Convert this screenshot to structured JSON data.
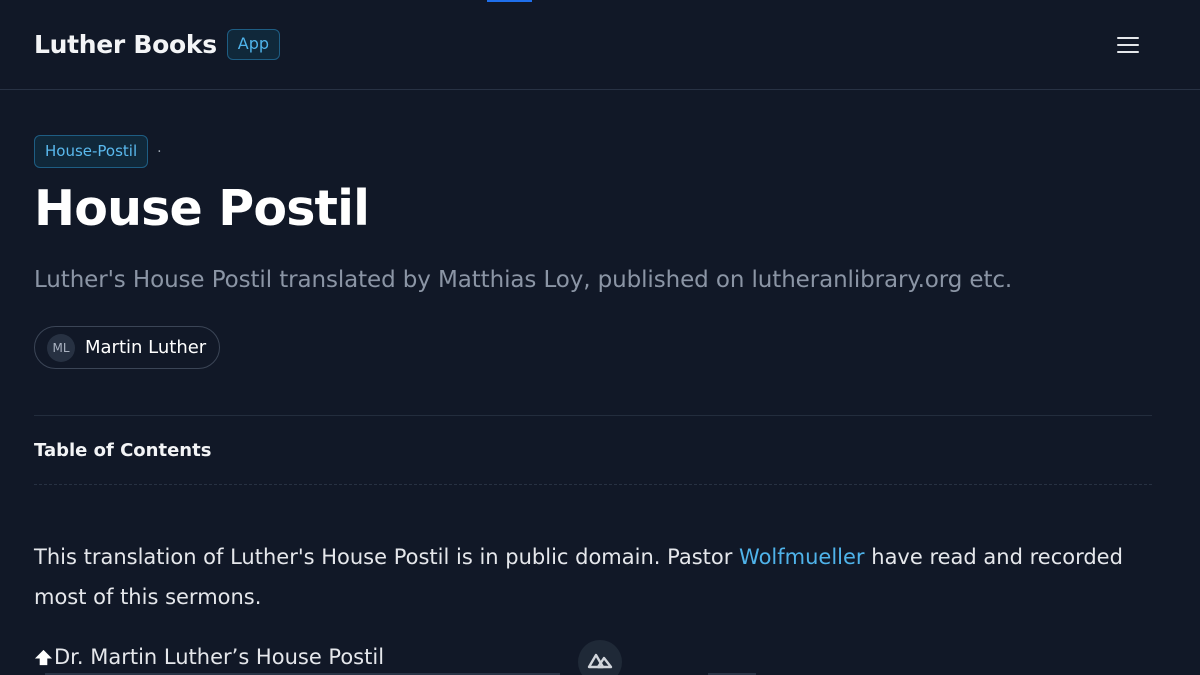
{
  "header": {
    "brand": "Luther Books",
    "app_badge": "App",
    "menu_icon": "hamburger-menu-icon"
  },
  "tag": {
    "label": "House-Postil",
    "separator": "·"
  },
  "page": {
    "title": "House Postil",
    "subtitle": "Luther's House Postil translated by Matthias Loy, published on lutheranlibrary.org etc."
  },
  "author": {
    "initials": "ML",
    "name": "Martin Luther"
  },
  "toc": {
    "heading": "Table of Contents"
  },
  "intro": {
    "text_before": "This translation of Luther's House Postil is in public domain. Pastor ",
    "link": "Wolfmueller",
    "text_after": " have read and recorded most of this sermons."
  },
  "chapter": {
    "label": "Dr. Martin Luther’s House Postil",
    "icon": "arrow-up-icon"
  },
  "colors": {
    "background": "#111827",
    "accent": "#4fb3ea",
    "muted_text": "#8b95a5"
  }
}
